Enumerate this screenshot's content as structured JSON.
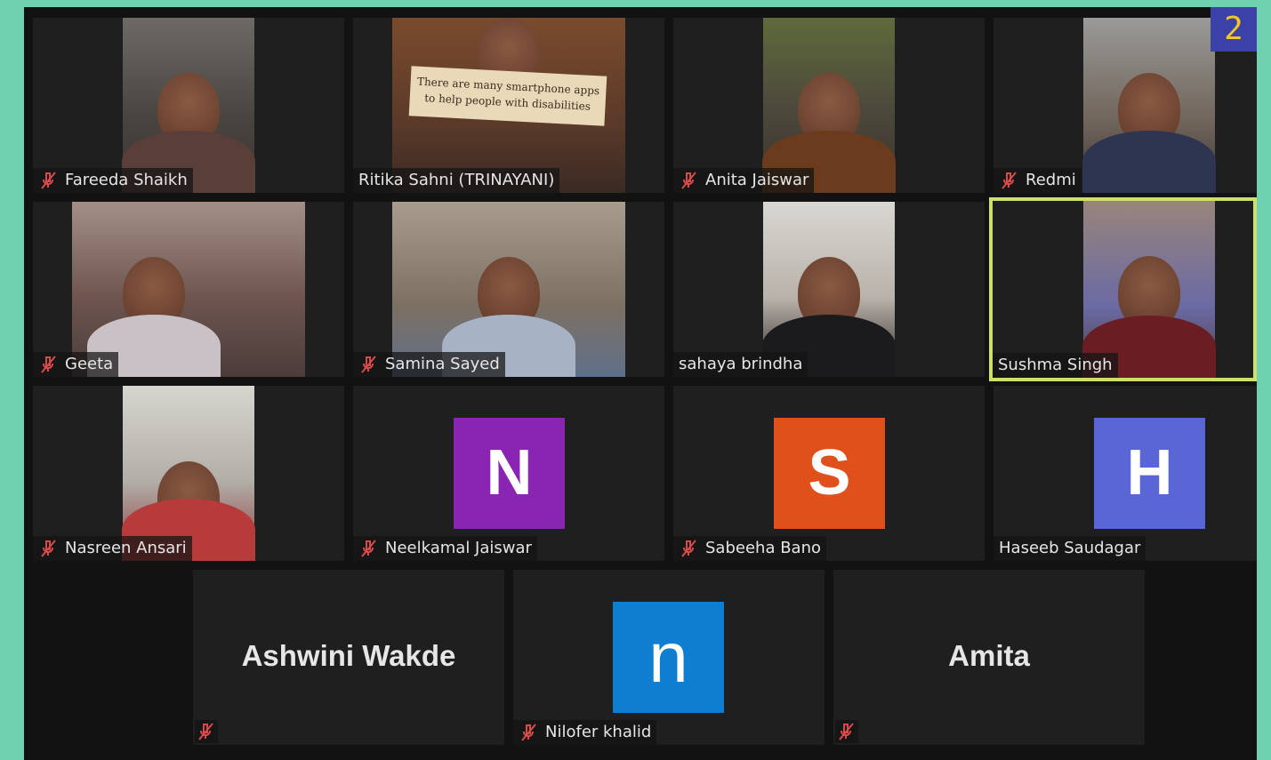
{
  "page_badge": "2",
  "participants": [
    {
      "name": "Fareeda Shaikh"
    },
    {
      "name": "Ritika Sahni (TRINAYANI)",
      "sign_text": "There are many smartphone apps to help people with disabilities"
    },
    {
      "name": "Anita Jaiswar"
    },
    {
      "name": "Redmi"
    },
    {
      "name": "Geeta"
    },
    {
      "name": "Samina Sayed"
    },
    {
      "name": "sahaya brindha"
    },
    {
      "name": "Sushma Singh"
    },
    {
      "name": "Nasreen Ansari"
    },
    {
      "name": "Neelkamal Jaiswar",
      "avatar_letter": "N",
      "avatar_color": "#8a24b2"
    },
    {
      "name": "Sabeeha Bano",
      "avatar_letter": "S",
      "avatar_color": "#e0501b"
    },
    {
      "name": "Haseeb Saudagar",
      "avatar_letter": "H",
      "avatar_color": "#5a66d6"
    },
    {
      "name": "Ashwini Wakde"
    },
    {
      "name": "Nilofer khalid",
      "avatar_letter": "n",
      "avatar_color": "#0e7fd0"
    },
    {
      "name": "Amita"
    }
  ]
}
